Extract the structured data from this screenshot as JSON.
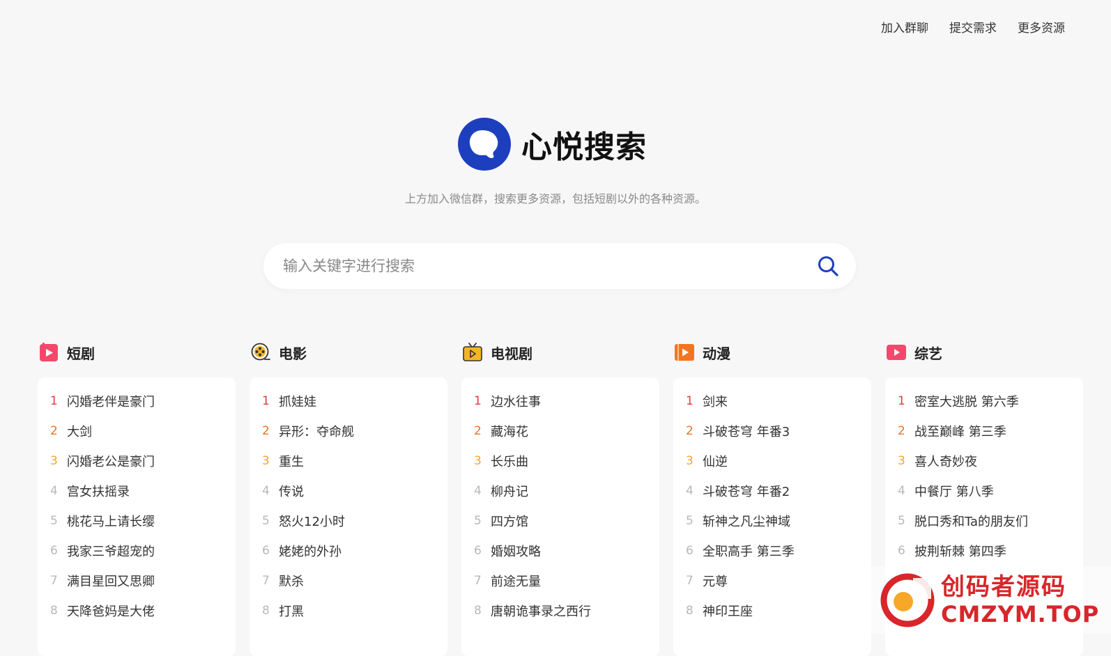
{
  "topnav": [
    "加入群聊",
    "提交需求",
    "更多资源"
  ],
  "brand": {
    "name": "心悦搜索",
    "logo_icon": "blue-ring-logo-icon",
    "color": "#1d3fbd"
  },
  "tagline": "上方加入微信群，搜索更多资源，包括短剧以外的各种资源。",
  "search": {
    "placeholder": "输入关键字进行搜索",
    "icon": "search-icon"
  },
  "columns": [
    {
      "title": "短剧",
      "icon": "play-square-icon",
      "color": "#f2496a",
      "items": [
        "闪婚老伴是豪门",
        "大剑",
        "闪婚老公是豪门",
        "宫女扶摇录",
        "桃花马上请长缨",
        "我家三爷超宠的",
        "满目星回又思卿",
        "天降爸妈是大佬"
      ]
    },
    {
      "title": "电影",
      "icon": "film-reel-icon",
      "color": "#f5b423",
      "items": [
        "抓娃娃",
        "异形：夺命舰",
        "重生",
        "传说",
        "怒火12小时",
        "姥姥的外孙",
        "默杀",
        "打黑"
      ]
    },
    {
      "title": "电视剧",
      "icon": "tv-icon",
      "color": "#f5b423",
      "items": [
        "边水往事",
        "藏海花",
        "长乐曲",
        "柳舟记",
        "四方馆",
        "婚姻攻略",
        "前途无量",
        "唐朝诡事录之西行"
      ]
    },
    {
      "title": "动漫",
      "icon": "play-icon",
      "color": "#f57422",
      "items": [
        "剑来",
        "斗破苍穹 年番3",
        "仙逆",
        "斗破苍穹 年番2",
        "斩神之凡尘神域",
        "全职高手 第三季",
        "元尊",
        "神印王座"
      ]
    },
    {
      "title": "综艺",
      "icon": "play-rect-icon",
      "color": "#f2496a",
      "items": [
        "密室大逃脱 第六季",
        "战至巅峰 第三季",
        "喜人奇妙夜",
        "中餐厅 第八季",
        "脱口秀和Ta的朋友们",
        "披荆斩棘 第四季",
        "",
        ""
      ]
    }
  ],
  "rank_colors": [
    "#e8373d",
    "#f0731f",
    "#f5a524"
  ],
  "watermark": {
    "cn": "创码者源码",
    "en": "CMZYM.TOP"
  }
}
